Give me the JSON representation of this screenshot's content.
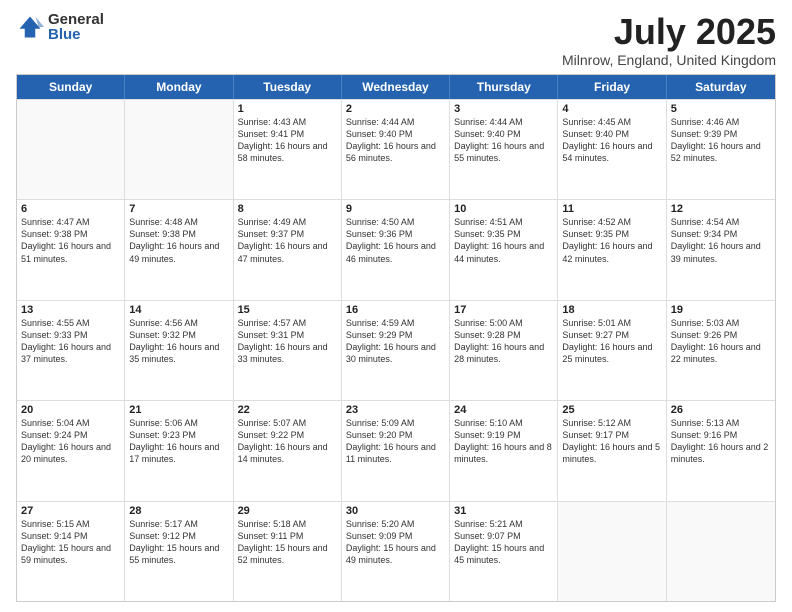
{
  "logo": {
    "general": "General",
    "blue": "Blue"
  },
  "title": "July 2025",
  "location": "Milnrow, England, United Kingdom",
  "days": [
    "Sunday",
    "Monday",
    "Tuesday",
    "Wednesday",
    "Thursday",
    "Friday",
    "Saturday"
  ],
  "weeks": [
    [
      {
        "day": "",
        "info": ""
      },
      {
        "day": "",
        "info": ""
      },
      {
        "day": "1",
        "info": "Sunrise: 4:43 AM\nSunset: 9:41 PM\nDaylight: 16 hours and 58 minutes."
      },
      {
        "day": "2",
        "info": "Sunrise: 4:44 AM\nSunset: 9:40 PM\nDaylight: 16 hours and 56 minutes."
      },
      {
        "day": "3",
        "info": "Sunrise: 4:44 AM\nSunset: 9:40 PM\nDaylight: 16 hours and 55 minutes."
      },
      {
        "day": "4",
        "info": "Sunrise: 4:45 AM\nSunset: 9:40 PM\nDaylight: 16 hours and 54 minutes."
      },
      {
        "day": "5",
        "info": "Sunrise: 4:46 AM\nSunset: 9:39 PM\nDaylight: 16 hours and 52 minutes."
      }
    ],
    [
      {
        "day": "6",
        "info": "Sunrise: 4:47 AM\nSunset: 9:38 PM\nDaylight: 16 hours and 51 minutes."
      },
      {
        "day": "7",
        "info": "Sunrise: 4:48 AM\nSunset: 9:38 PM\nDaylight: 16 hours and 49 minutes."
      },
      {
        "day": "8",
        "info": "Sunrise: 4:49 AM\nSunset: 9:37 PM\nDaylight: 16 hours and 47 minutes."
      },
      {
        "day": "9",
        "info": "Sunrise: 4:50 AM\nSunset: 9:36 PM\nDaylight: 16 hours and 46 minutes."
      },
      {
        "day": "10",
        "info": "Sunrise: 4:51 AM\nSunset: 9:35 PM\nDaylight: 16 hours and 44 minutes."
      },
      {
        "day": "11",
        "info": "Sunrise: 4:52 AM\nSunset: 9:35 PM\nDaylight: 16 hours and 42 minutes."
      },
      {
        "day": "12",
        "info": "Sunrise: 4:54 AM\nSunset: 9:34 PM\nDaylight: 16 hours and 39 minutes."
      }
    ],
    [
      {
        "day": "13",
        "info": "Sunrise: 4:55 AM\nSunset: 9:33 PM\nDaylight: 16 hours and 37 minutes."
      },
      {
        "day": "14",
        "info": "Sunrise: 4:56 AM\nSunset: 9:32 PM\nDaylight: 16 hours and 35 minutes."
      },
      {
        "day": "15",
        "info": "Sunrise: 4:57 AM\nSunset: 9:31 PM\nDaylight: 16 hours and 33 minutes."
      },
      {
        "day": "16",
        "info": "Sunrise: 4:59 AM\nSunset: 9:29 PM\nDaylight: 16 hours and 30 minutes."
      },
      {
        "day": "17",
        "info": "Sunrise: 5:00 AM\nSunset: 9:28 PM\nDaylight: 16 hours and 28 minutes."
      },
      {
        "day": "18",
        "info": "Sunrise: 5:01 AM\nSunset: 9:27 PM\nDaylight: 16 hours and 25 minutes."
      },
      {
        "day": "19",
        "info": "Sunrise: 5:03 AM\nSunset: 9:26 PM\nDaylight: 16 hours and 22 minutes."
      }
    ],
    [
      {
        "day": "20",
        "info": "Sunrise: 5:04 AM\nSunset: 9:24 PM\nDaylight: 16 hours and 20 minutes."
      },
      {
        "day": "21",
        "info": "Sunrise: 5:06 AM\nSunset: 9:23 PM\nDaylight: 16 hours and 17 minutes."
      },
      {
        "day": "22",
        "info": "Sunrise: 5:07 AM\nSunset: 9:22 PM\nDaylight: 16 hours and 14 minutes."
      },
      {
        "day": "23",
        "info": "Sunrise: 5:09 AM\nSunset: 9:20 PM\nDaylight: 16 hours and 11 minutes."
      },
      {
        "day": "24",
        "info": "Sunrise: 5:10 AM\nSunset: 9:19 PM\nDaylight: 16 hours and 8 minutes."
      },
      {
        "day": "25",
        "info": "Sunrise: 5:12 AM\nSunset: 9:17 PM\nDaylight: 16 hours and 5 minutes."
      },
      {
        "day": "26",
        "info": "Sunrise: 5:13 AM\nSunset: 9:16 PM\nDaylight: 16 hours and 2 minutes."
      }
    ],
    [
      {
        "day": "27",
        "info": "Sunrise: 5:15 AM\nSunset: 9:14 PM\nDaylight: 15 hours and 59 minutes."
      },
      {
        "day": "28",
        "info": "Sunrise: 5:17 AM\nSunset: 9:12 PM\nDaylight: 15 hours and 55 minutes."
      },
      {
        "day": "29",
        "info": "Sunrise: 5:18 AM\nSunset: 9:11 PM\nDaylight: 15 hours and 52 minutes."
      },
      {
        "day": "30",
        "info": "Sunrise: 5:20 AM\nSunset: 9:09 PM\nDaylight: 15 hours and 49 minutes."
      },
      {
        "day": "31",
        "info": "Sunrise: 5:21 AM\nSunset: 9:07 PM\nDaylight: 15 hours and 45 minutes."
      },
      {
        "day": "",
        "info": ""
      },
      {
        "day": "",
        "info": ""
      }
    ]
  ]
}
